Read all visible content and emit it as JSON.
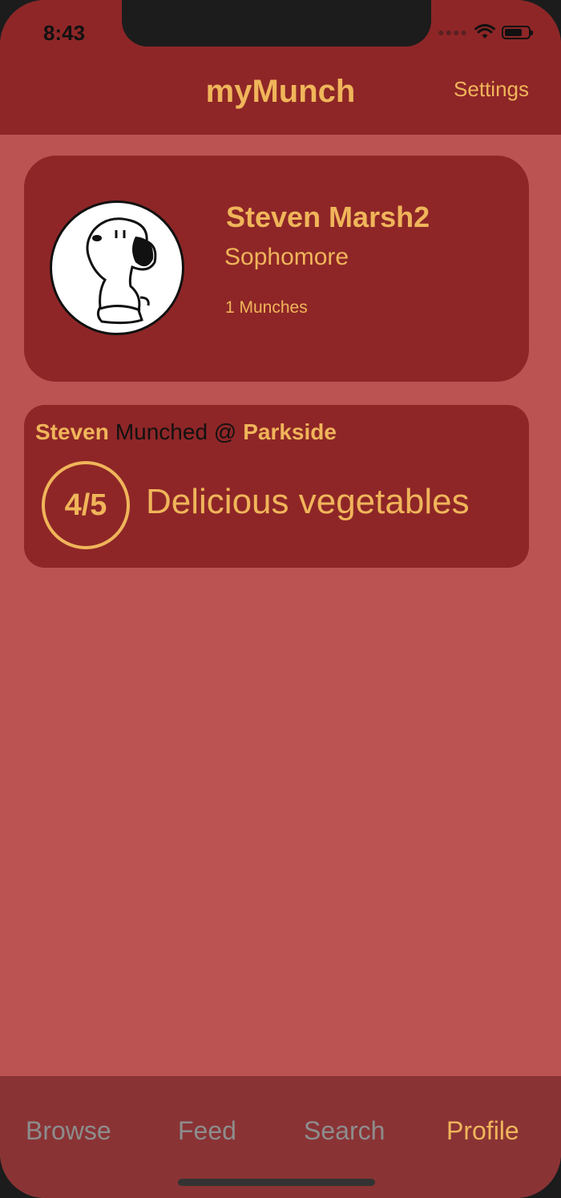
{
  "status_bar": {
    "time": "8:43",
    "battery_level": 0.75
  },
  "header": {
    "title": "myMunch",
    "settings_label": "Settings"
  },
  "profile": {
    "name": "Steven Marsh2",
    "year": "Sophomore",
    "munch_count": "1 Munches",
    "avatar_icon": "snoopy-avatar"
  },
  "feed": [
    {
      "user": "Steven",
      "action": "Munched @",
      "place": "Parkside",
      "rating": "4/5",
      "review": "Delicious vegetables"
    }
  ],
  "tabs": [
    {
      "label": "Browse",
      "active": false
    },
    {
      "label": "Feed",
      "active": false
    },
    {
      "label": "Search",
      "active": false
    },
    {
      "label": "Profile",
      "active": true
    }
  ],
  "colors": {
    "accent": "#f0b55a",
    "card": "#8e2627",
    "background": "#bb5352",
    "tabbar": "#8a3335",
    "inactive_tab": "#8d8d8d"
  }
}
